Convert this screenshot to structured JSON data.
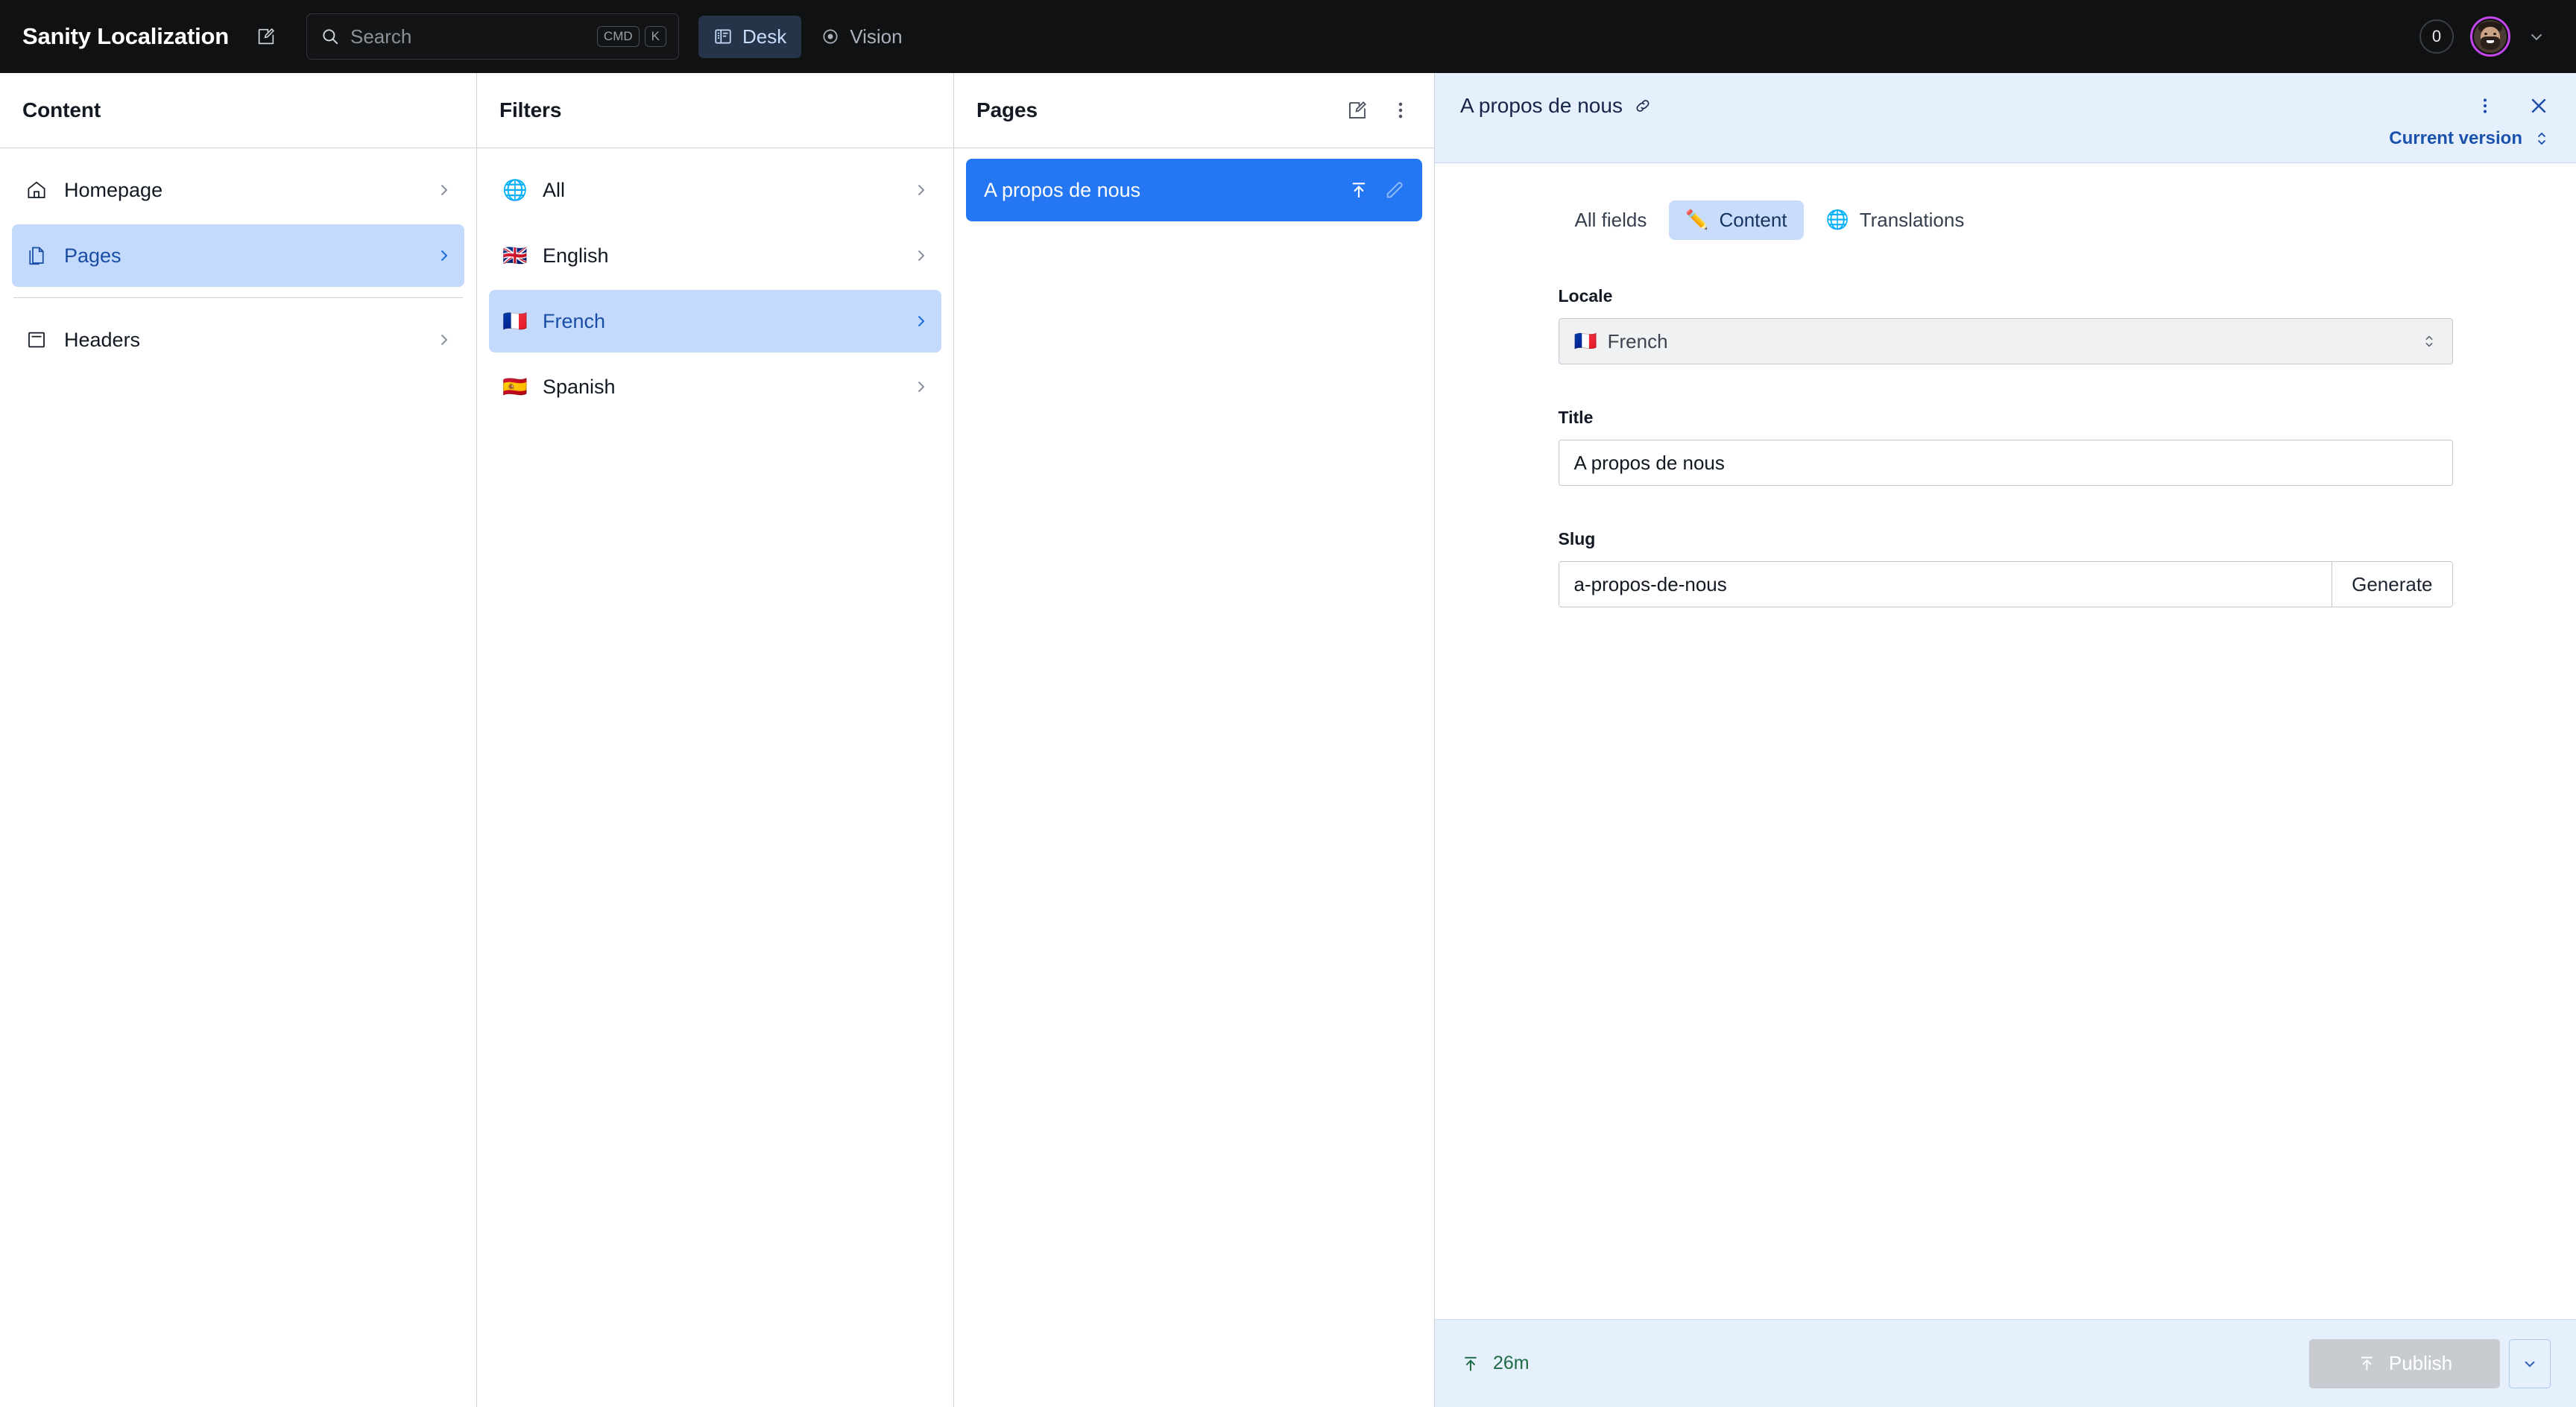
{
  "topnav": {
    "brand": "Sanity Localization",
    "compose_icon": "compose-icon",
    "search": {
      "placeholder": "Search",
      "icon": "search-icon",
      "kbd_cmd": "CMD",
      "kbd_key": "K"
    },
    "tabs": [
      {
        "label": "Desk",
        "icon": "structure-icon",
        "active": true
      },
      {
        "label": "Vision",
        "icon": "eye-icon",
        "active": false
      }
    ],
    "notification_count": "0",
    "avatar_ring_color": "#c447ee",
    "user_menu_icon": "chevron-down-icon"
  },
  "content_pane": {
    "title": "Content",
    "items": [
      {
        "label": "Homepage",
        "icon": "home-icon",
        "selected": false
      },
      {
        "label": "Pages",
        "icon": "documents-icon",
        "selected": true
      },
      {
        "label": "Headers",
        "icon": "header-block-icon",
        "selected": false
      }
    ]
  },
  "filters_pane": {
    "title": "Filters",
    "items": [
      {
        "label": "All",
        "emoji": "🌐",
        "selected": false
      },
      {
        "label": "English",
        "emoji": "🇬🇧",
        "selected": false
      },
      {
        "label": "French",
        "emoji": "🇫🇷",
        "selected": true
      },
      {
        "label": "Spanish",
        "emoji": "🇪🇸",
        "selected": false
      }
    ]
  },
  "pages_pane": {
    "title": "Pages",
    "create_icon": "compose-icon",
    "menu_icon": "more-vertical-icon",
    "documents": [
      {
        "label": "A propos de nous",
        "selected": true,
        "publish_icon": "publish-icon",
        "edit_icon": "pencil-icon"
      }
    ]
  },
  "document": {
    "title": "A propos de nous",
    "link_icon": "link-icon",
    "menu_icon": "more-vertical-icon",
    "close_icon": "close-icon",
    "version_label": "Current version",
    "version_arrows_icon": "chevron-updown-icon",
    "tabs": [
      {
        "label": "All fields",
        "emoji": "",
        "active": false
      },
      {
        "label": "Content",
        "emoji": "✏️",
        "active": true
      },
      {
        "label": "Translations",
        "emoji": "🌐",
        "active": false
      }
    ],
    "fields": {
      "locale": {
        "label": "Locale",
        "value": "French",
        "emoji": "🇫🇷"
      },
      "title": {
        "label": "Title",
        "value": "A propos de nous"
      },
      "slug": {
        "label": "Slug",
        "value": "a-propos-de-nous",
        "button_label": "Generate"
      }
    },
    "footer": {
      "status_icon": "publish-icon",
      "status_text": "26m",
      "status_color": "#1f6b46",
      "publish_label": "Publish",
      "publish_icon": "publish-icon",
      "publish_more_icon": "chevron-down-icon"
    }
  }
}
